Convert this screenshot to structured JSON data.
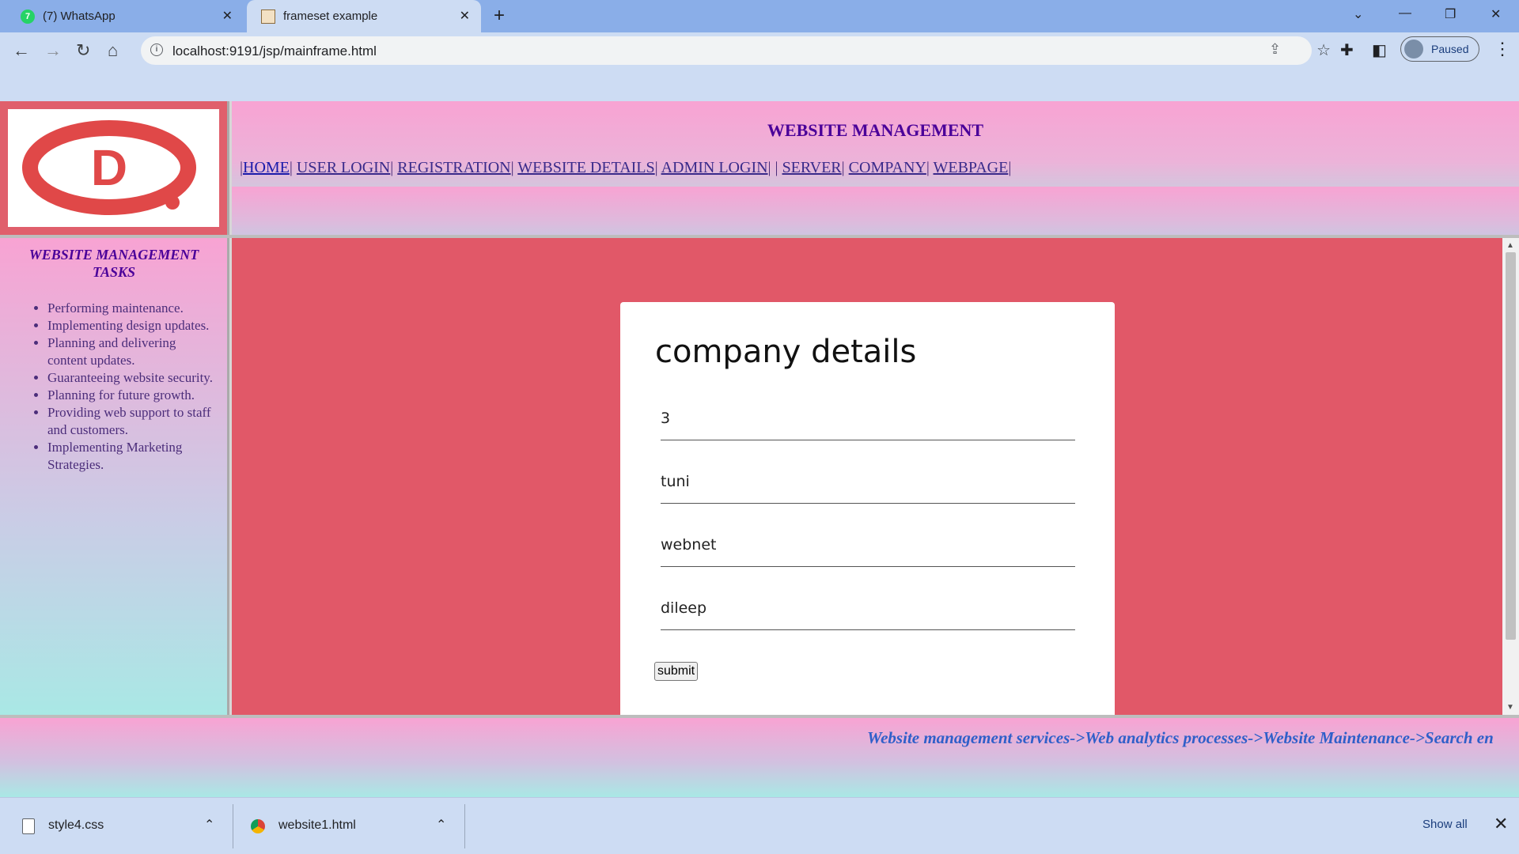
{
  "browser": {
    "tabs": [
      {
        "title": "(7) WhatsApp",
        "active": false,
        "badge": "7"
      },
      {
        "title": "frameset example",
        "active": true
      }
    ],
    "url": "localhost:9191/jsp/mainframe.html",
    "profile_status": "Paused"
  },
  "header": {
    "title": "WEBSITE MANAGEMENT",
    "nav": [
      "HOME",
      "USER LOGIN",
      "REGISTRATION",
      "WEBSITE DETAILS",
      "ADMIN LOGIN",
      "SERVER",
      "COMPANY",
      "WEBPAGE"
    ]
  },
  "logo": {
    "letter": "D",
    "color": "#e04848"
  },
  "sidebar": {
    "title": "WEBSITE MANAGEMENT TASKS",
    "items": [
      "Performing maintenance.",
      "Implementing design updates.",
      "Planning and delivering content updates.",
      "Guaranteeing website security.",
      "Planning for future growth.",
      "Providing web support to staff and customers.",
      "Implementing Marketing Strategies."
    ]
  },
  "form": {
    "title": "company details",
    "fields": [
      "3",
      "tuni",
      "webnet",
      "dileep"
    ],
    "submit_label": "submit"
  },
  "footer": {
    "marquee": "Website management services->Web analytics processes->Website Maintenance->Search en"
  },
  "downloads": {
    "items": [
      {
        "name": "style4.css",
        "icon": "file-icon"
      },
      {
        "name": "website1.html",
        "icon": "chrome-icon"
      }
    ],
    "show_all": "Show all"
  },
  "colors": {
    "main_bg": "#e15868",
    "header_title": "#4a0099",
    "marquee": "#2f5fc9"
  }
}
